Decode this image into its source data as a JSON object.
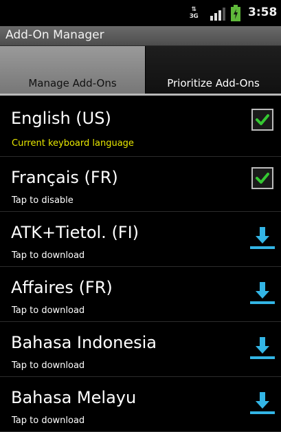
{
  "status_bar": {
    "network": "3G",
    "time": "3:58"
  },
  "title": "Add-On Manager",
  "tabs": [
    {
      "label": "Manage Add-Ons",
      "selected": true
    },
    {
      "label": "Prioritize Add-Ons",
      "selected": false
    }
  ],
  "items": [
    {
      "title": "English (US)",
      "subtitle": "Current keyboard language",
      "action": "checkbox",
      "checked": true
    },
    {
      "title": "Français (FR)",
      "subtitle": "Tap to disable",
      "action": "checkbox",
      "checked": true
    },
    {
      "title": "ATK+Tietol. (FI)",
      "subtitle": "Tap to download",
      "action": "download-icon"
    },
    {
      "title": "Affaires (FR)",
      "subtitle": "Tap to download",
      "action": "download-icon"
    },
    {
      "title": "Bahasa Indonesia",
      "subtitle": "Tap to download",
      "action": "download-icon"
    },
    {
      "title": "Bahasa Melayu",
      "subtitle": "Tap to download",
      "action": "download-icon"
    }
  ],
  "colors": {
    "highlight_subtitle": "#e8e800",
    "check_green": "#35c832",
    "download_blue": "#33b5e5"
  }
}
